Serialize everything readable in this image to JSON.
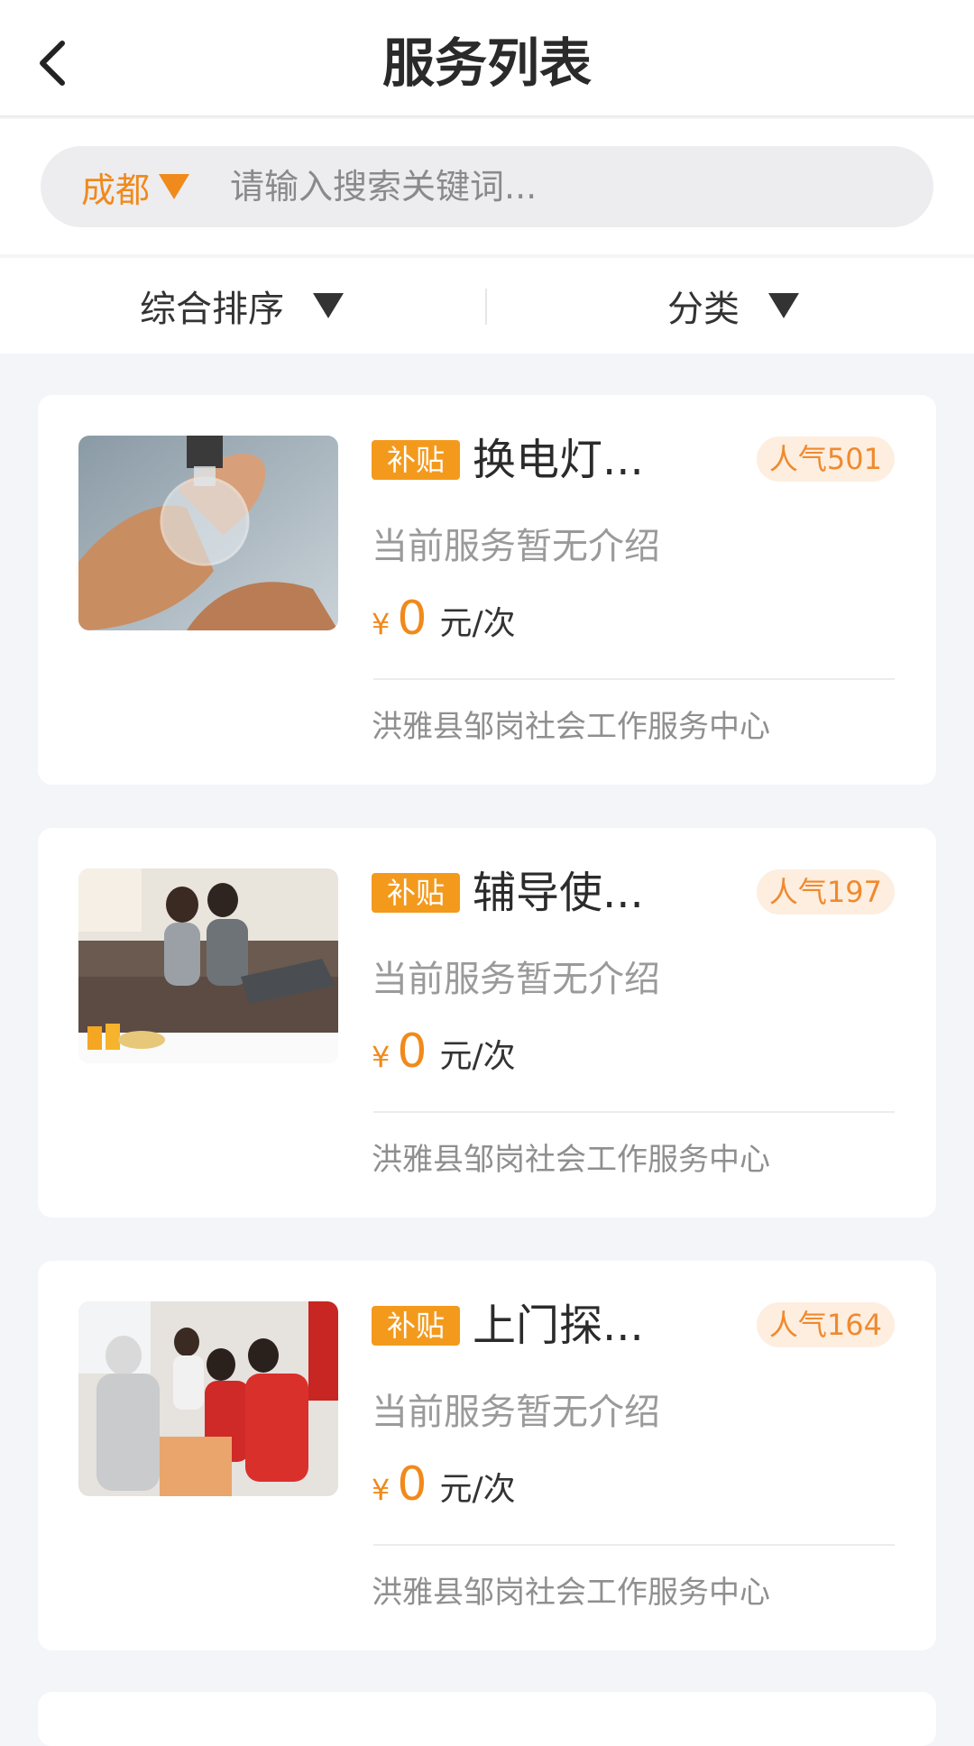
{
  "header": {
    "title": "服务列表"
  },
  "search": {
    "city": "成都",
    "placeholder": "请输入搜索关键词..."
  },
  "filters": [
    {
      "label": "综合排序"
    },
    {
      "label": "分类"
    }
  ],
  "items": [
    {
      "badge": "补贴",
      "title": "换电灯...",
      "popularity": "人气501",
      "description": "当前服务暂无介绍",
      "currency": "¥",
      "price": "0",
      "unit": "元/次",
      "org": "洪雅县邹岗社会工作服务中心",
      "image": "lightbulb-photo"
    },
    {
      "badge": "补贴",
      "title": "辅导使...",
      "popularity": "人气197",
      "description": "当前服务暂无介绍",
      "currency": "¥",
      "price": "0",
      "unit": "元/次",
      "org": "洪雅县邹岗社会工作服务中心",
      "image": "couple-on-sofa-photo"
    },
    {
      "badge": "补贴",
      "title": "上门探...",
      "popularity": "人气164",
      "description": "当前服务暂无介绍",
      "currency": "¥",
      "price": "0",
      "unit": "元/次",
      "org": "洪雅县邹岗社会工作服务中心",
      "image": "volunteers-visit-photo"
    }
  ],
  "colors": {
    "accent": "#f08a1c",
    "badge": "#f39a1d",
    "background": "#f4f5f9"
  }
}
